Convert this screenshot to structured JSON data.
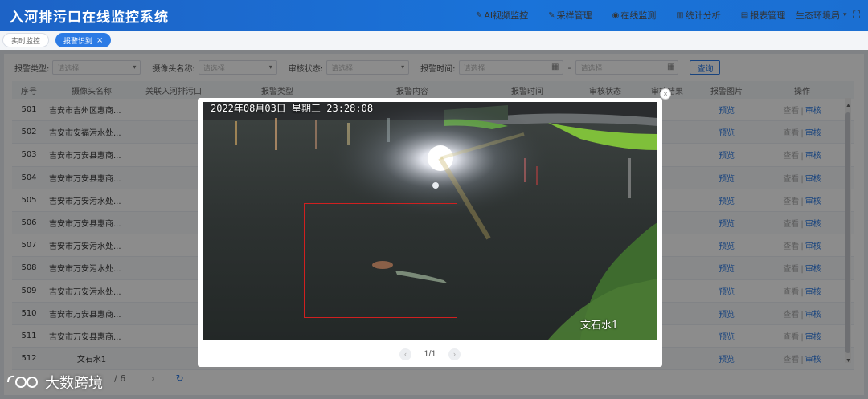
{
  "header": {
    "title": "入河排污口在线监控系统",
    "nav": [
      {
        "icon": "ai-video-icon",
        "glyph": "✎",
        "label": "AI视频监控"
      },
      {
        "icon": "sampling-icon",
        "glyph": "✎",
        "label": "采样管理"
      },
      {
        "icon": "online-monitor-icon",
        "glyph": "◉",
        "label": "在线监测"
      },
      {
        "icon": "stats-icon",
        "glyph": "▥",
        "label": "统计分析"
      },
      {
        "icon": "report-icon",
        "glyph": "▤",
        "label": "报表管理"
      }
    ],
    "user": "生态环境局",
    "fullscreen_glyph": "⛶"
  },
  "tabs": [
    {
      "label": "实时监控",
      "active": false
    },
    {
      "label": "报警识别",
      "active": true,
      "close": "×"
    }
  ],
  "filters": {
    "alarm_type": {
      "label": "报警类型:",
      "placeholder": "请选择"
    },
    "camera_name": {
      "label": "摄像头名称:",
      "placeholder": "请选择"
    },
    "audit_status": {
      "label": "审核状态:",
      "placeholder": "请选择"
    },
    "alarm_time": {
      "label": "报警时间:",
      "start_placeholder": "请选择",
      "sep": "-",
      "end_placeholder": "请选择"
    },
    "query_label": "查询"
  },
  "table": {
    "headers": [
      "序号",
      "摄像头名称",
      "关联入河排污口",
      "报警类型",
      "报警内容",
      "报警时间",
      "审核状态",
      "审核结果",
      "报警图片",
      "操作"
    ],
    "rows": [
      {
        "no": "501",
        "camera": "吉安市吉州区惠商..."
      },
      {
        "no": "502",
        "camera": "吉安市安福污水处..."
      },
      {
        "no": "503",
        "camera": "吉安市万安县惠商..."
      },
      {
        "no": "504",
        "camera": "吉安市万安县惠商..."
      },
      {
        "no": "505",
        "camera": "吉安市万安污水处..."
      },
      {
        "no": "506",
        "camera": "吉安市万安县惠商..."
      },
      {
        "no": "507",
        "camera": "吉安市万安污水处..."
      },
      {
        "no": "508",
        "camera": "吉安市万安污水处..."
      },
      {
        "no": "509",
        "camera": "吉安市万安污水处..."
      },
      {
        "no": "510",
        "camera": "吉安市万安县惠商..."
      },
      {
        "no": "511",
        "camera": "吉安市万安县惠商..."
      },
      {
        "no": "512",
        "camera": "文石水1"
      }
    ],
    "preview_label": "预览",
    "view_label": "查看",
    "sep": "|",
    "audit_label": "审核"
  },
  "pager": {
    "page_text": "/ 6",
    "next_glyph": "›",
    "refresh_glyph": "↻"
  },
  "modal": {
    "close_glyph": "×",
    "osd_timestamp": "2022年08月03日  星期三  23:28:08",
    "osd_camera": "文石水1",
    "page_indicator": "1/1",
    "prev_glyph": "‹",
    "next_glyph": "›"
  },
  "watermark": {
    "text": "大数跨境"
  },
  "colors": {
    "primary": "#2c7be5",
    "header": "#1a6fd6",
    "detect_box": "#d02020"
  }
}
